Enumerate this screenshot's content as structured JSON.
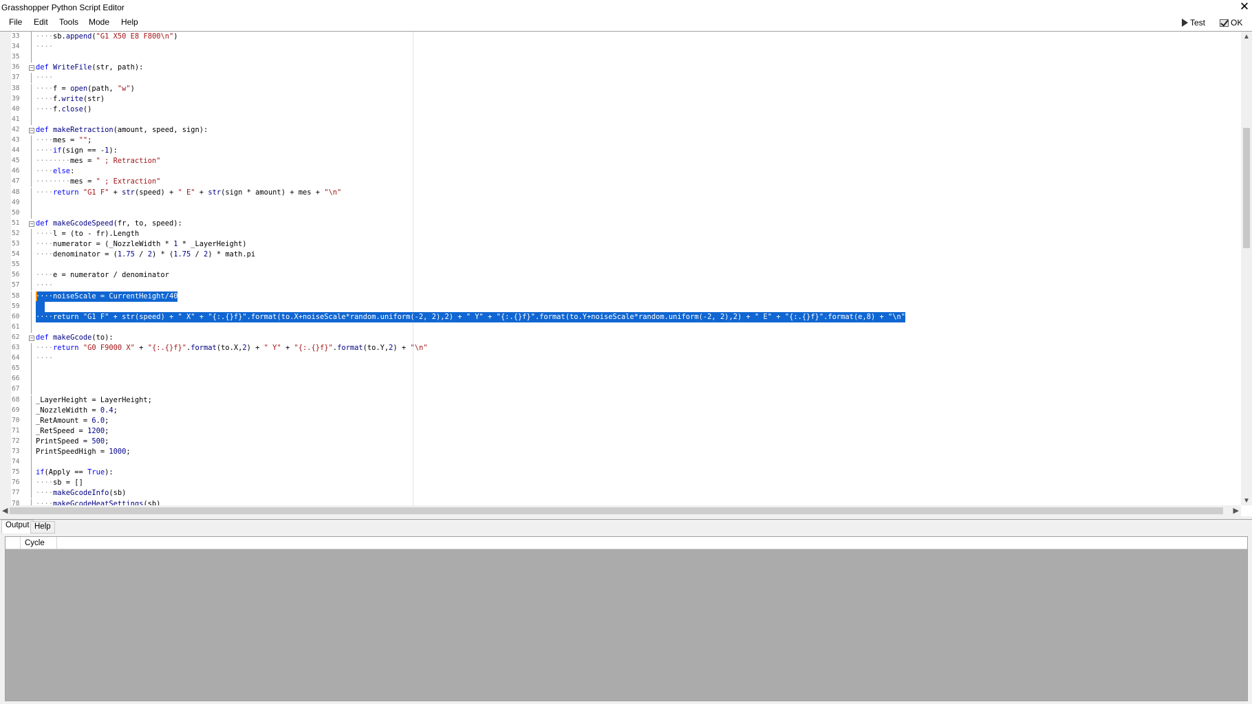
{
  "window": {
    "title": "Grasshopper Python Script Editor",
    "close_glyph": "✕"
  },
  "menu": {
    "items": [
      "File",
      "Edit",
      "Tools",
      "Mode",
      "Help"
    ],
    "test_label": "Test",
    "ok_label": "OK"
  },
  "editor": {
    "lines": [
      {
        "n": "33",
        "code": "····sb.append(\"G1 X50 E8 F800\\n\")"
      },
      {
        "n": "34",
        "code": "····"
      },
      {
        "n": "35",
        "code": ""
      },
      {
        "n": "36",
        "code": "def WriteFile(str, path):"
      },
      {
        "n": "37",
        "code": "····"
      },
      {
        "n": "38",
        "code": "····f = open(path, \"w\")"
      },
      {
        "n": "39",
        "code": "····f.write(str)"
      },
      {
        "n": "40",
        "code": "····f.close()"
      },
      {
        "n": "41",
        "code": ""
      },
      {
        "n": "42",
        "code": "def makeRetraction(amount, speed, sign):"
      },
      {
        "n": "43",
        "code": "····mes = \"\";"
      },
      {
        "n": "44",
        "code": "····if(sign == -1):"
      },
      {
        "n": "45",
        "code": "········mes = \" ; Retraction\""
      },
      {
        "n": "46",
        "code": "····else:"
      },
      {
        "n": "47",
        "code": "········mes = \" ; Extraction\""
      },
      {
        "n": "48",
        "code": "····return \"G1 F\" + str(speed) + \" E\" + str(sign * amount) + mes + \"\\n\""
      },
      {
        "n": "49",
        "code": ""
      },
      {
        "n": "50",
        "code": ""
      },
      {
        "n": "51",
        "code": "def makeGcodeSpeed(fr, to, speed):"
      },
      {
        "n": "52",
        "code": "····l = (to - fr).Length"
      },
      {
        "n": "53",
        "code": "····numerator = (_NozzleWidth * 1 * _LayerHeight)"
      },
      {
        "n": "54",
        "code": "····denominator = (1.75 / 2) * (1.75 / 2) * math.pi"
      },
      {
        "n": "55",
        "code": ""
      },
      {
        "n": "56",
        "code": "····e = numerator / denominator"
      },
      {
        "n": "57",
        "code": "····"
      },
      {
        "n": "58",
        "code": "····noiseScale = CurrentHeight/40"
      },
      {
        "n": "59",
        "code": "  "
      },
      {
        "n": "60",
        "code": "····return \"G1 F\" + str(speed) + \" X\" + \"{:.{}f}\".format(to.X+noiseScale*random.uniform(-2, 2),2) + \" Y\" + \"{:.{}f}\".format(to.Y+noiseScale*random.uniform(-2, 2),2) + \" E\" + \"{:.{}f}\".format(e,8) + \"\\n\""
      },
      {
        "n": "61",
        "code": ""
      },
      {
        "n": "62",
        "code": "def makeGcode(to):"
      },
      {
        "n": "63",
        "code": "····return \"G0 F9000 X\" + \"{:.{}f}\".format(to.X,2) + \" Y\" + \"{:.{}f}\".format(to.Y,2) + \"\\n\""
      },
      {
        "n": "64",
        "code": "····"
      },
      {
        "n": "65",
        "code": ""
      },
      {
        "n": "66",
        "code": ""
      },
      {
        "n": "67",
        "code": ""
      },
      {
        "n": "68",
        "code": "_LayerHeight = LayerHeight;"
      },
      {
        "n": "69",
        "code": "_NozzleWidth = 0.4;"
      },
      {
        "n": "70",
        "code": "_RetAmount = 6.0;"
      },
      {
        "n": "71",
        "code": "_RetSpeed = 1200;"
      },
      {
        "n": "72",
        "code": "PrintSpeed = 500;"
      },
      {
        "n": "73",
        "code": "PrintSpeedHigh = 1000;"
      },
      {
        "n": "74",
        "code": ""
      },
      {
        "n": "75",
        "code": "if(Apply == True):"
      },
      {
        "n": "76",
        "code": "····sb = []"
      },
      {
        "n": "77",
        "code": "····makeGcodeInfo(sb)"
      },
      {
        "n": "78",
        "code": "····makeGcodeHeatSettings(sb)"
      }
    ],
    "fold_lines": [
      "36",
      "42",
      "51",
      "62"
    ],
    "selected_lines": [
      "58",
      "59",
      "60"
    ],
    "selection_color": "#1066d2"
  },
  "output": {
    "tabs": [
      "Output",
      "Help"
    ],
    "active_tab": "Output",
    "columns": [
      "",
      "Cycle"
    ],
    "background": "#ababab"
  }
}
